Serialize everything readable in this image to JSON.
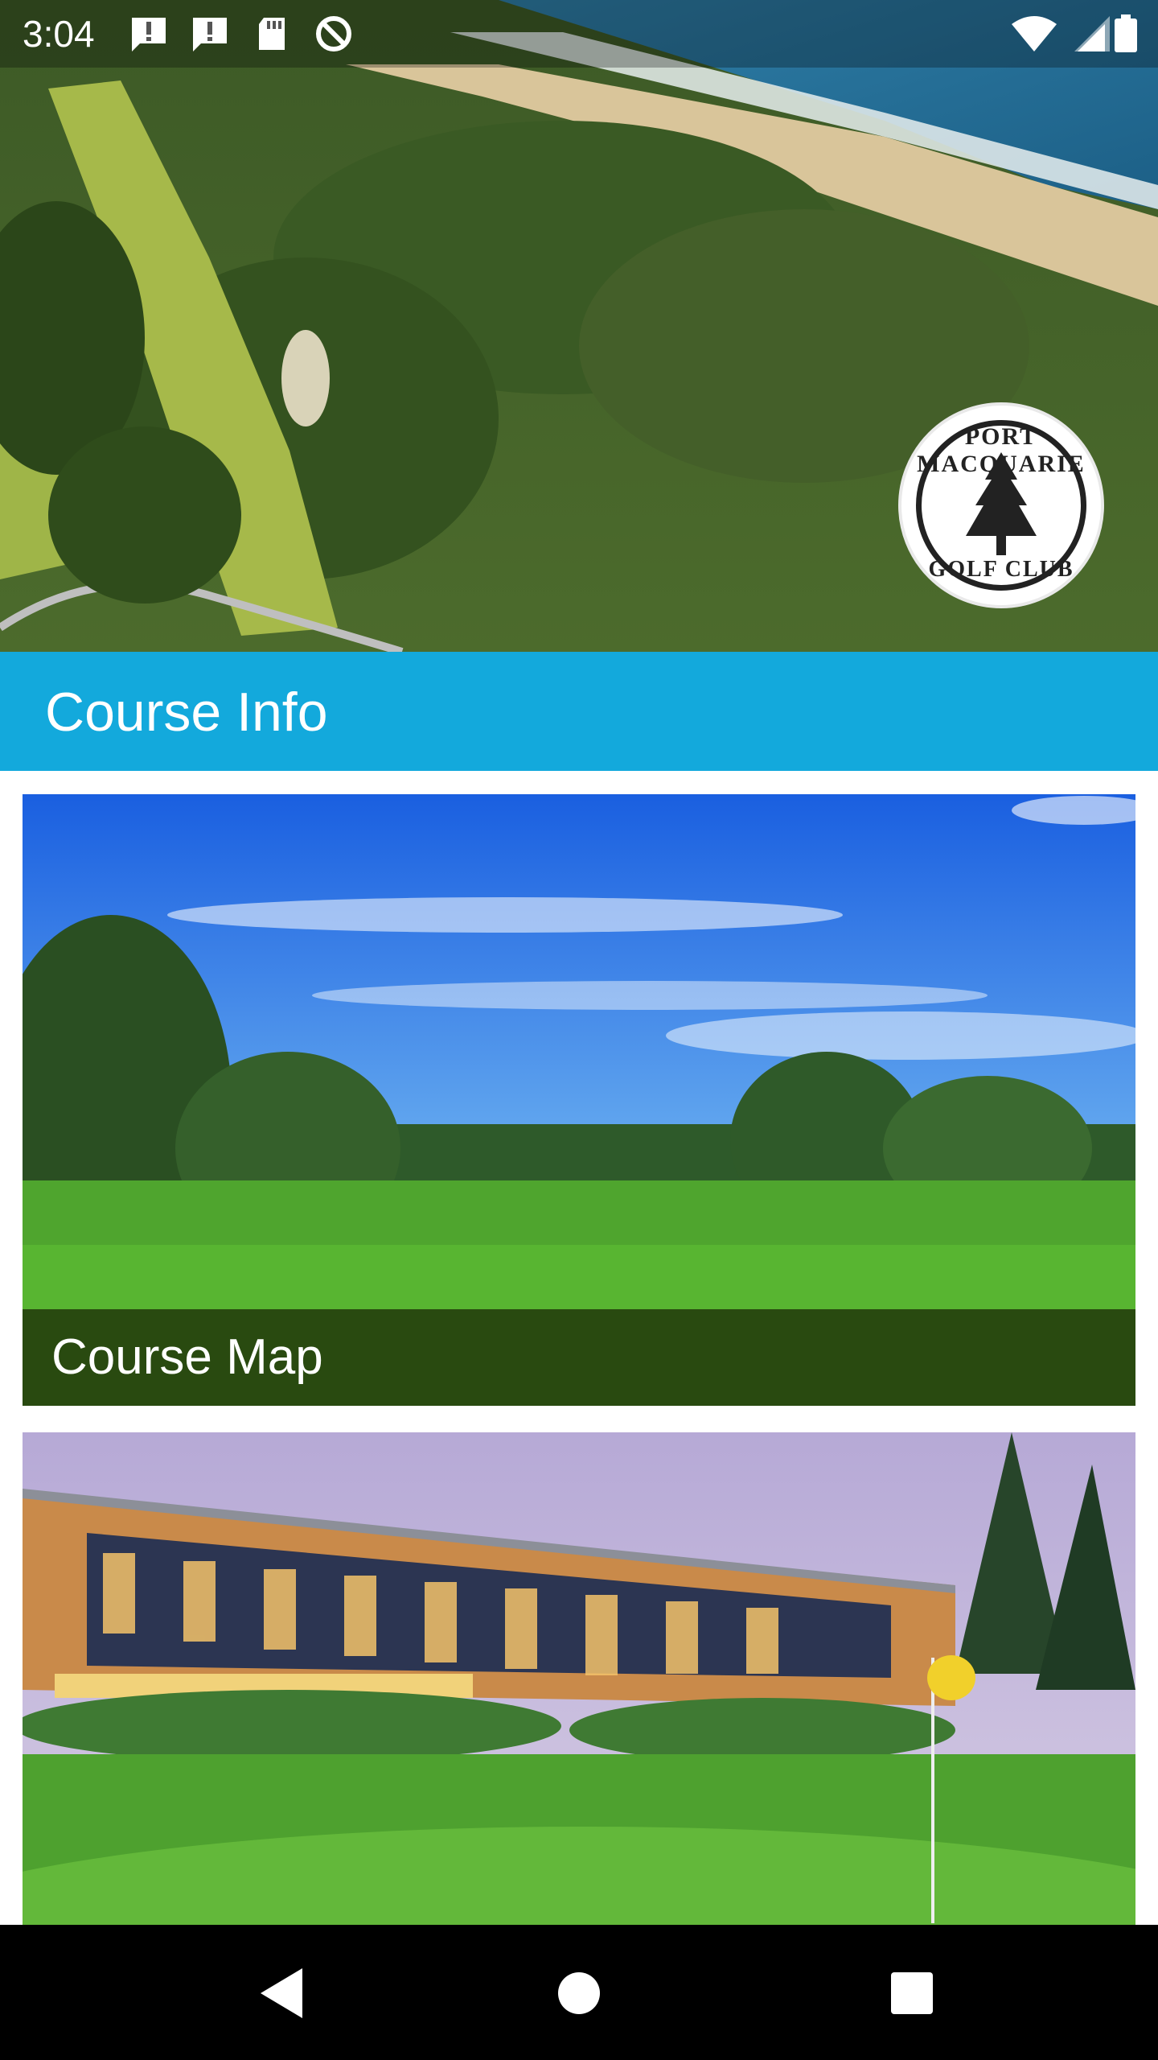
{
  "status_bar": {
    "time": "3:04",
    "left_icons": [
      "alert-icon",
      "alert-icon",
      "sd-card-icon",
      "do-not-disturb-icon"
    ],
    "right_icons": [
      "wifi-icon",
      "signal-icon",
      "battery-icon"
    ]
  },
  "hero": {
    "logo": {
      "top_text": "PORT MACQUARIE",
      "bottom_text": "GOLF CLUB",
      "icon": "pine-tree-icon"
    }
  },
  "section": {
    "title": "Course Info"
  },
  "cards": [
    {
      "label": "Course Map"
    },
    {
      "label": ""
    }
  ],
  "nav": {
    "back_icon": "back-triangle-icon",
    "home_icon": "home-circle-icon",
    "recents_icon": "recents-square-icon"
  },
  "colors": {
    "section_header": "#13a9dc",
    "nav_bar": "#000000"
  }
}
